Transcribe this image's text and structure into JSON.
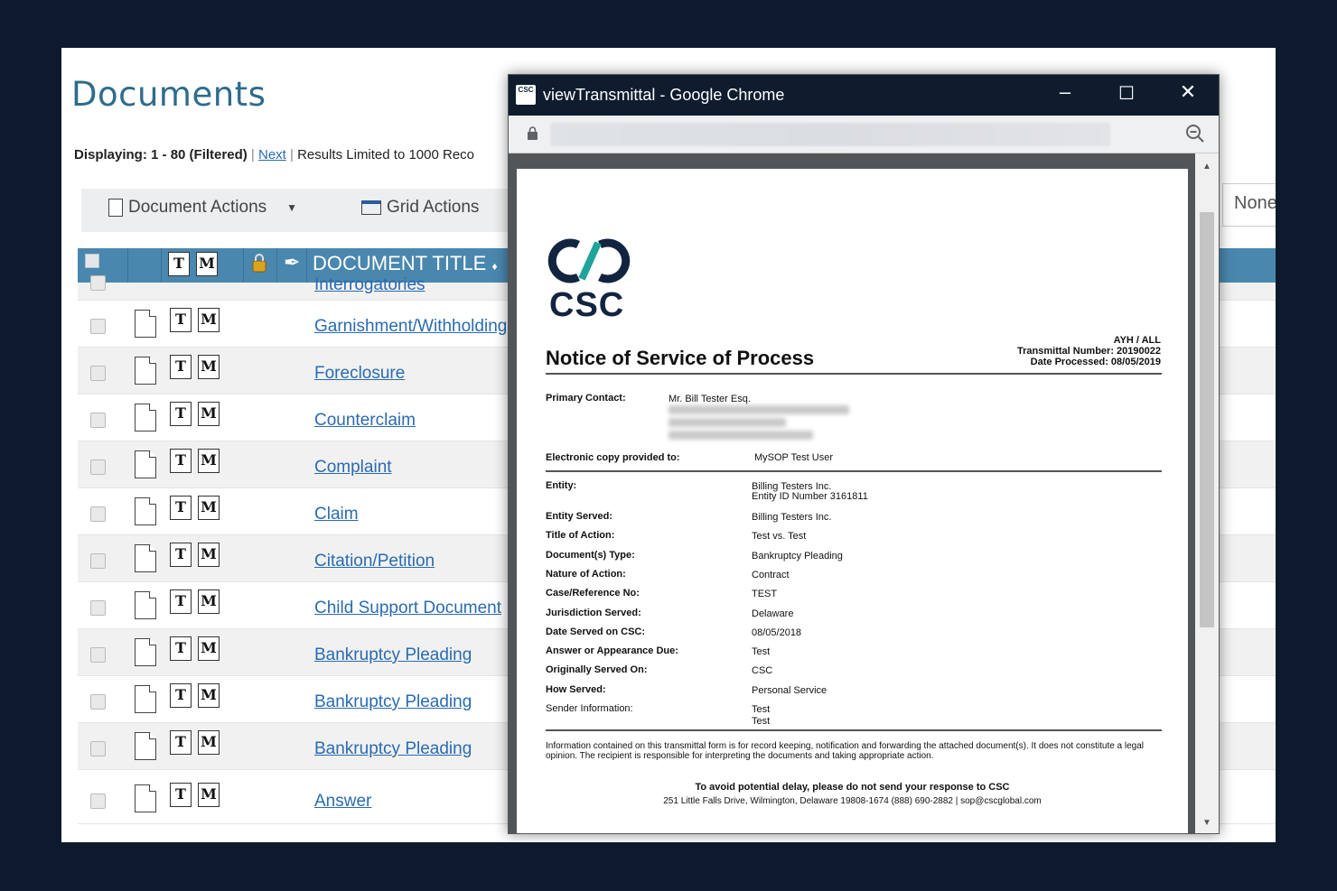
{
  "page": {
    "title": "Documents",
    "displaying_label": "Displaying:",
    "displaying_range": "1 - 80 (Filtered)",
    "next_link": "Next",
    "results_limited": "Results Limited to 1000 Reco",
    "document_actions": "Document Actions",
    "grid_actions": "Grid Actions",
    "filter_value": "None"
  },
  "grid": {
    "header_title": "DOCUMENT TITLE",
    "sort_indicator": "♦",
    "t_label": "T",
    "m_label": "M",
    "partial_row_title": "Interrogatories",
    "rows": [
      {
        "title": "Garnishment/Withholding"
      },
      {
        "title": "Foreclosure"
      },
      {
        "title": "Counterclaim"
      },
      {
        "title": "Complaint"
      },
      {
        "title": "Claim"
      },
      {
        "title": "Citation/Petition"
      },
      {
        "title": "Child Support Document"
      },
      {
        "title": "Bankruptcy Pleading"
      },
      {
        "title": "Bankruptcy Pleading"
      },
      {
        "title": "Bankruptcy Pleading"
      },
      {
        "title": "Answer"
      }
    ]
  },
  "popup": {
    "window_title": "viewTransmittal - Google Chrome",
    "logo_badge": "CSC",
    "minimize": "–",
    "maximize": "☐",
    "close": "✕",
    "document": {
      "logo_text": "CSC",
      "heading": "Notice of Service of Process",
      "meta": {
        "code": "AYH / ALL",
        "transmittal": "Transmittal Number: 20190022",
        "processed": "Date Processed: 08/05/2019"
      },
      "primary_contact_label": "Primary Contact:",
      "primary_contact_value": "Mr. Bill Tester Esq.",
      "electronic_copy_label": "Electronic copy provided to:",
      "electronic_copy_value": "MySOP Test User",
      "entity_label": "Entity:",
      "entity_value": "Billing Testers Inc.",
      "entity_id": "Entity ID Number 3161811",
      "fields": [
        {
          "label": "Entity Served:",
          "value": "Billing Testers Inc."
        },
        {
          "label": "Title of Action:",
          "value": "Test vs. Test"
        },
        {
          "label": "Document(s) Type:",
          "value": "Bankruptcy Pleading"
        },
        {
          "label": "Nature of Action:",
          "value": "Contract"
        },
        {
          "label": "Case/Reference No:",
          "value": "TEST"
        },
        {
          "label": "Jurisdiction Served:",
          "value": "Delaware"
        },
        {
          "label": "Date Served on CSC:",
          "value": "08/05/2018"
        },
        {
          "label": "Answer or Appearance Due:",
          "value": "Test"
        },
        {
          "label": "Originally Served On:",
          "value": "CSC"
        },
        {
          "label": "How Served:",
          "value": "Personal Service"
        }
      ],
      "sender_label": "Sender Information:",
      "sender_line1": "Test",
      "sender_line2": "Test",
      "disclaimer": "Information contained on this transmittal form is for record keeping, notification and forwarding the attached document(s). It does not constitute a legal opinion. The recipient is responsible for interpreting the documents and taking appropriate action.",
      "avoid_delay": "To avoid potential delay, please do not send your response to CSC",
      "address_line": "251 Little Falls Drive, Wilmington, Delaware 19808-1674   (888) 690-2882  |  sop@cscglobal.com"
    }
  },
  "colors": {
    "background": "#0d1a2e",
    "header_blue": "#4a87ae",
    "link_blue": "#2a6bb0",
    "title_teal": "#2e6c8a",
    "csc_navy": "#12243f",
    "csc_teal": "#1fa39a"
  }
}
